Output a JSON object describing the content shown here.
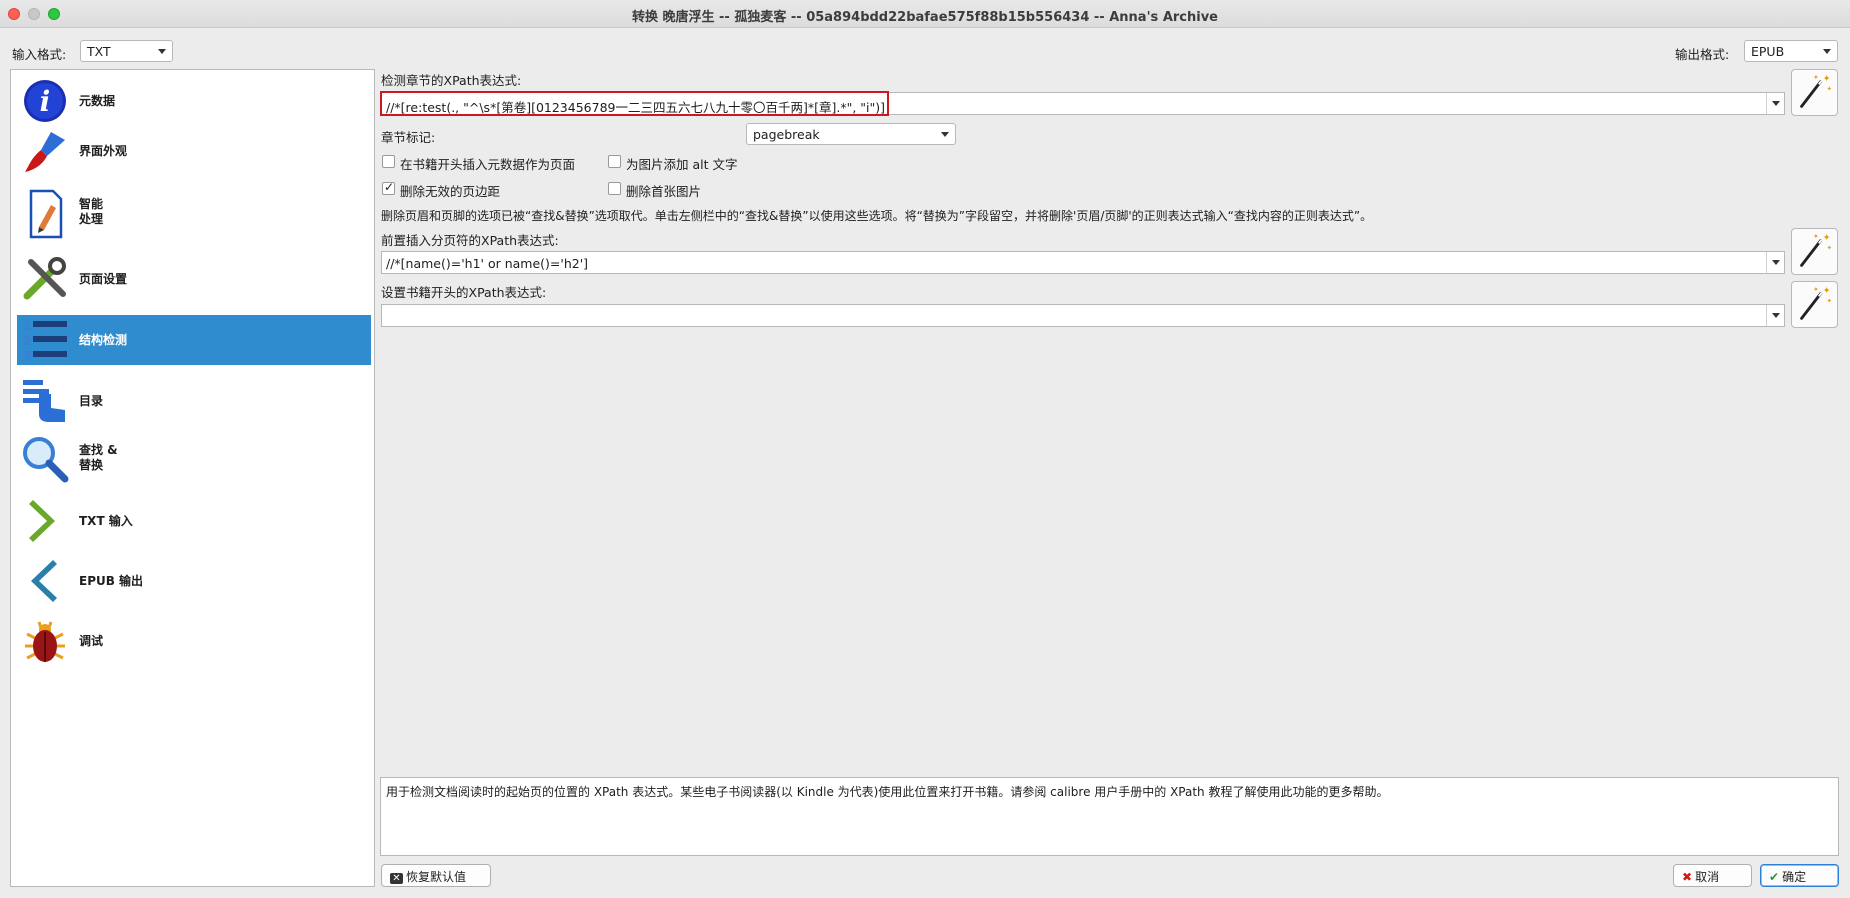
{
  "window": {
    "title": "转换 晚唐浮生 -- 孤独麦客 -- 05a894bdd22bafae575f88b15b556434 -- Anna's Archive"
  },
  "input_format": {
    "label": "输入格式:",
    "value": "TXT"
  },
  "output_format": {
    "label": "输出格式:",
    "value": "EPUB"
  },
  "sidebar": {
    "items": [
      {
        "label": "元数据",
        "icon": "info-icon"
      },
      {
        "label": "界面外观",
        "icon": "paintbrush-icon"
      },
      {
        "label": "智能\n处理",
        "icon": "document-edit-icon"
      },
      {
        "label": "页面设置",
        "icon": "tools-icon"
      },
      {
        "label": "结构检测",
        "icon": "list-icon"
      },
      {
        "label": "目录",
        "icon": "toc-hand-icon"
      },
      {
        "label": "查找 &\n替换",
        "icon": "magnifier-icon"
      },
      {
        "label": "TXT 输入",
        "icon": "chevron-right-icon"
      },
      {
        "label": "EPUB 输出",
        "icon": "chevron-left-icon"
      },
      {
        "label": "调试",
        "icon": "bug-icon"
      }
    ],
    "active_index": 4
  },
  "structure": {
    "chapter_xpath_label": "检测章节的XPath表达式:",
    "chapter_xpath_value": "//*[re:test(., \"^\\s*[第卷][0123456789一二三四五六七八九十零〇百千两]*[章].*\", \"i\")]",
    "chapter_mark_label": "章节标记:",
    "chapter_mark_value": "pagebreak",
    "checkbox_insert_metadata": "在书籍开头插入元数据作为页面",
    "checkbox_alt_text": "为图片添加 alt 文字",
    "checkbox_remove_margins": "删除无效的页边距",
    "checkbox_remove_first_image": "删除首张图片",
    "info_text": "删除页眉和页脚的选项已被“查找&替换”选项取代。单击左侧栏中的“查找&替换”以使用这些选项。将“替换为”字段留空，并将删除'页眉/页脚'的正则表达式输入“查找内容的正则表达式”。",
    "pagebreak_xpath_label": "前置插入分页符的XPath表达式:",
    "pagebreak_xpath_value": "//*[name()='h1' or name()='h2']",
    "start_xpath_label": "设置书籍开头的XPath表达式:",
    "start_xpath_value": ""
  },
  "help_text": "用于检测文档阅读时的起始页的位置的 XPath 表达式。某些电子书阅读器(以 Kindle 为代表)使用此位置来打开书籍。请参阅 calibre 用户手册中的 XPath 教程了解使用此功能的更多帮助。",
  "buttons": {
    "restore": "恢复默认值",
    "cancel": "取消",
    "ok": "确定"
  }
}
